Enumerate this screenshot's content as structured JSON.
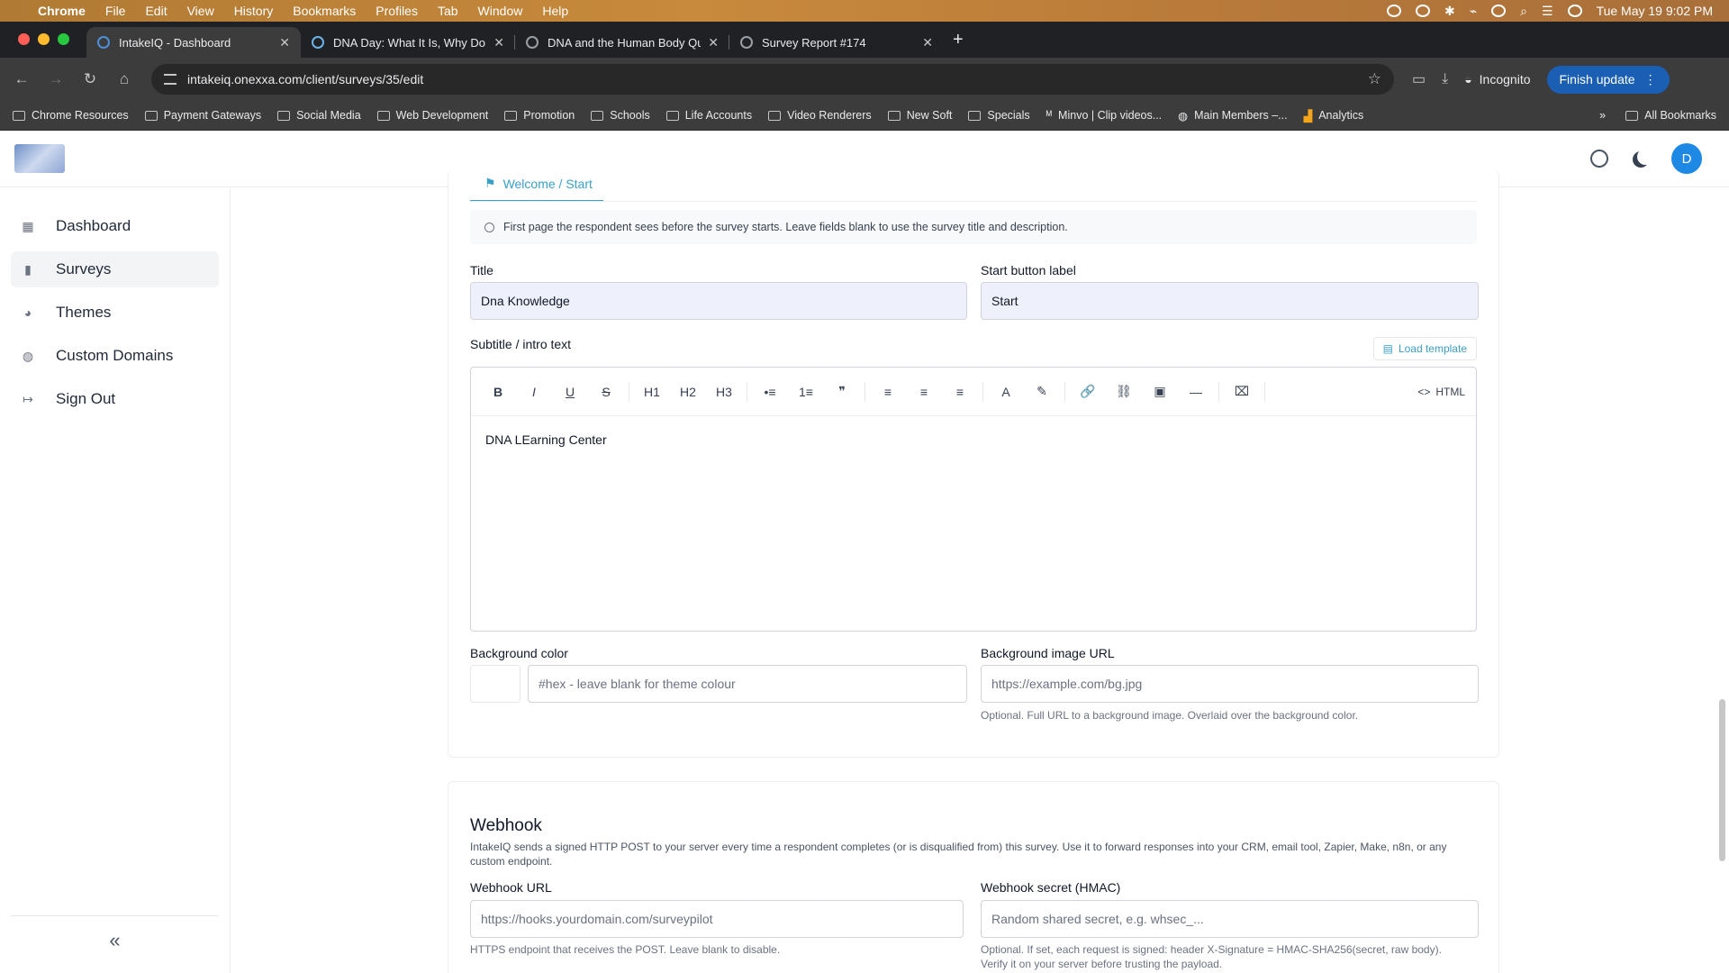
{
  "menubar": {
    "app": "Chrome",
    "items": [
      "File",
      "Edit",
      "View",
      "History",
      "Bookmarks",
      "Profiles",
      "Tab",
      "Window",
      "Help"
    ],
    "clock": "Tue May 19  9:02 PM"
  },
  "tabs": [
    {
      "label": "IntakeIQ - Dashboard"
    },
    {
      "label": "DNA Day: What It Is, Why Do"
    },
    {
      "label": "DNA and the Human Body Qu"
    },
    {
      "label": "Survey Report #174"
    }
  ],
  "toolbar": {
    "url": "intakeiq.onexxa.com/client/surveys/35/edit",
    "incognito": "Incognito",
    "finish_update": "Finish update"
  },
  "bookmarks": [
    "Chrome Resources",
    "Payment Gateways",
    "Social Media",
    "Web Development",
    "Promotion",
    "Schools",
    "Life Accounts",
    "Video Renderers",
    "New Soft",
    "Specials",
    "Minvo | Clip videos...",
    "Main Members –...",
    "Analytics"
  ],
  "all_bookmarks": "All Bookmarks",
  "header": {
    "avatar_letter": "D"
  },
  "sidebar": {
    "items": [
      {
        "label": "Dashboard"
      },
      {
        "label": "Surveys"
      },
      {
        "label": "Themes"
      },
      {
        "label": "Custom Domains"
      },
      {
        "label": "Sign Out"
      }
    ],
    "collapse": "«"
  },
  "welcome": {
    "tab_label": "Welcome / Start",
    "info": "First page the respondent sees before the survey starts. Leave fields blank to use the survey title and description.",
    "title_label": "Title",
    "title_value": "Dna Knowledge",
    "start_label": "Start button label",
    "start_value": "Start",
    "subtitle_label": "Subtitle / intro text",
    "load_template": "Load template",
    "editor_toolbar": [
      "B",
      "I",
      "U",
      "S",
      "H1",
      "H2",
      "H3",
      "•≡",
      "1≡",
      "❞",
      "≡",
      "≡",
      "≡",
      "A",
      "✎",
      "🔗",
      "⛓",
      "▣",
      "—",
      "⌧"
    ],
    "html_label": "HTML",
    "editor_text": "DNA LEarning Center",
    "bgcolor_label": "Background color",
    "bgcolor_placeholder": "#hex - leave blank for theme colour",
    "bgimage_label": "Background image URL",
    "bgimage_placeholder": "https://example.com/bg.jpg",
    "bgimage_helper": "Optional. Full URL to a background image. Overlaid over the background color."
  },
  "webhook": {
    "title": "Webhook",
    "description": "IntakeIQ sends a signed HTTP POST to your server every time a respondent completes (or is disqualified from) this survey. Use it to forward responses into your CRM, email tool, Zapier, Make, n8n, or any custom endpoint.",
    "url_label": "Webhook URL",
    "url_placeholder": "https://hooks.yourdomain.com/surveypilot",
    "url_helper": "HTTPS endpoint that receives the POST. Leave blank to disable.",
    "secret_label": "Webhook secret (HMAC)",
    "secret_placeholder": "Random shared secret, e.g. whsec_...",
    "secret_helper_1": "Optional. If set, each request is signed: header X-Signature = HMAC-SHA256(secret, raw body).",
    "secret_helper_2": "Verify it on your server before trusting the payload."
  },
  "colors": {
    "accent": "#3aa0c8",
    "avatar": "#1e88e5",
    "finish_button": "#1a5fb4"
  }
}
